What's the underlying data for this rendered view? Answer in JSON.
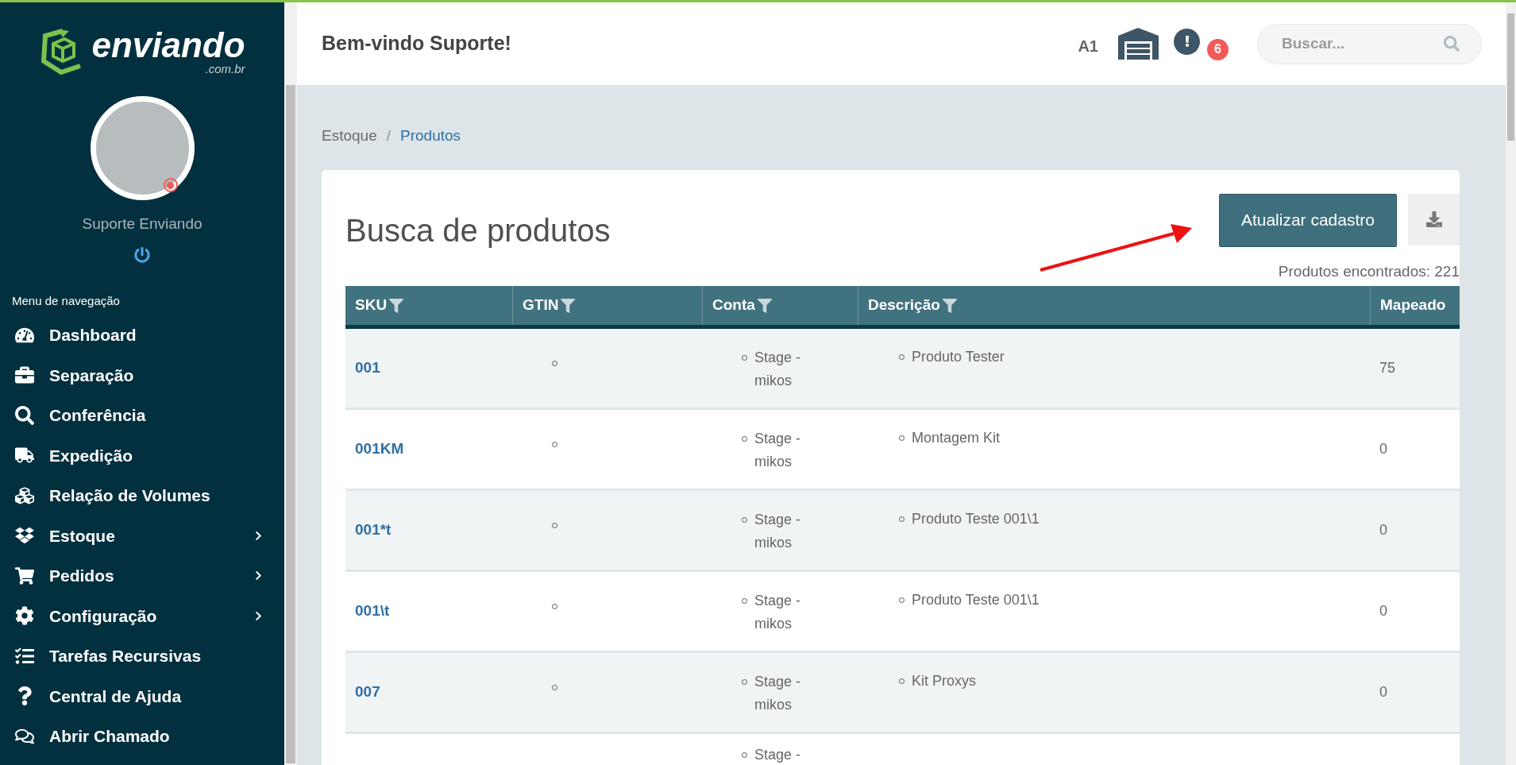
{
  "brand": {
    "name": "enviando",
    "suffix": ".com.br"
  },
  "user": {
    "name": "Suporte Enviando"
  },
  "nav": {
    "heading": "Menu de navegação",
    "items": [
      {
        "label": "Dashboard",
        "expandable": false
      },
      {
        "label": "Separação",
        "expandable": false
      },
      {
        "label": "Conferência",
        "expandable": false
      },
      {
        "label": "Expedição",
        "expandable": false
      },
      {
        "label": "Relação de Volumes",
        "expandable": false
      },
      {
        "label": "Estoque",
        "expandable": true
      },
      {
        "label": "Pedidos",
        "expandable": true
      },
      {
        "label": "Configuração",
        "expandable": true
      },
      {
        "label": "Tarefas Recursivas",
        "expandable": false
      },
      {
        "label": "Central de Ajuda",
        "expandable": false
      },
      {
        "label": "Abrir Chamado",
        "expandable": false
      }
    ]
  },
  "header": {
    "greeting": "Bem-vindo Suporte!",
    "location": "A1",
    "alert_count": "6",
    "search": {
      "placeholder": "Buscar..."
    }
  },
  "breadcrumb": [
    {
      "label": "Estoque",
      "current": false
    },
    {
      "label": "Produtos",
      "current": true,
      "separator": "/"
    }
  ],
  "panel": {
    "title": "Busca de produtos",
    "update_button": "Atualizar cadastro",
    "result_count": "Produtos encontrados: 221"
  },
  "table": {
    "columns": [
      {
        "label": "SKU",
        "filter": true
      },
      {
        "label": "GTIN",
        "filter": true
      },
      {
        "label": "Conta",
        "filter": true
      },
      {
        "label": "Descrição",
        "filter": true
      },
      {
        "label": "Mapeado",
        "filter": false
      }
    ],
    "rows": [
      {
        "sku": "001",
        "gtin_bullet": true,
        "conta": [
          "Stage - mikos"
        ],
        "descricao": [
          "Produto Tester"
        ],
        "mapeado": "75"
      },
      {
        "sku": "001KM",
        "gtin_bullet": true,
        "conta": [
          "Stage - mikos"
        ],
        "descricao": [
          "Montagem Kit"
        ],
        "mapeado": "0"
      },
      {
        "sku": "001*t",
        "gtin_bullet": true,
        "conta": [
          "Stage - mikos"
        ],
        "descricao": [
          "Produto Teste 001\\1"
        ],
        "mapeado": "0"
      },
      {
        "sku": "001\\t",
        "gtin_bullet": true,
        "conta": [
          "Stage - mikos"
        ],
        "descricao": [
          "Produto Teste 001\\1"
        ],
        "mapeado": "0"
      },
      {
        "sku": "007",
        "gtin_bullet": true,
        "conta": [
          "Stage - mikos"
        ],
        "descricao": [
          "Kit Proxys"
        ],
        "mapeado": "0"
      },
      {
        "conta": [
          "Stage -"
        ]
      }
    ]
  }
}
